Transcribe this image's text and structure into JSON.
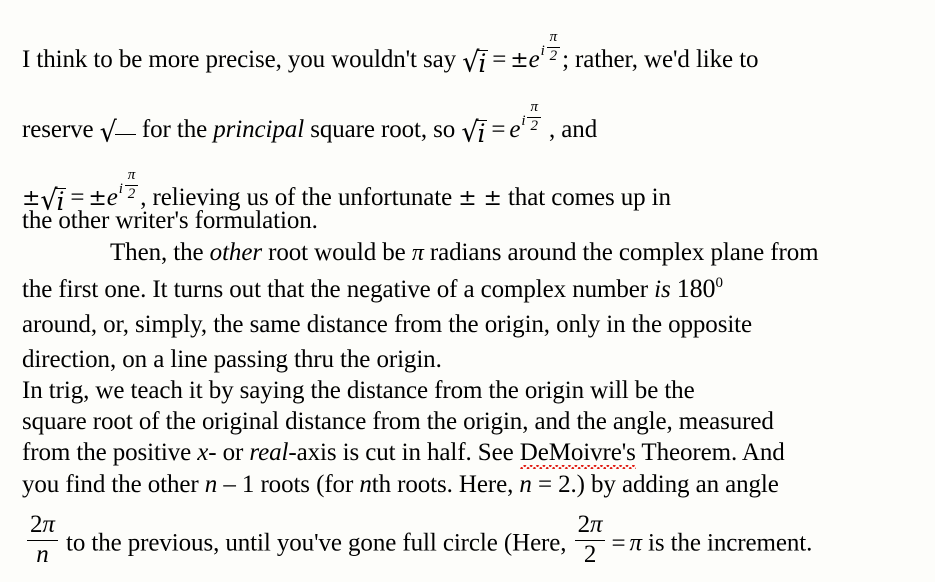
{
  "document": {
    "background_color": "#fdfdfa",
    "text_color": "#000000",
    "spellcheck_underline_color": "#e01b12",
    "lines": {
      "l1_a": "I think to be more precise, you wouldn't say ",
      "l1_b": "; rather, we'd like to",
      "l2_a": "reserve ",
      "l2_b": " for the ",
      "l2_italic": "principal",
      "l2_c": " square root, so ",
      "l2_d": " , and",
      "l3_b": ", relieving us of the unfortunate ",
      "l3_c": " that comes up in",
      "l4": "the other writer's formulation.",
      "l5_a": "Then, the ",
      "l5_italic": "other",
      "l5_b": " root would be ",
      "l5_c": " radians around the complex plane from",
      "l6_a": "the first one.  It turns out that the negative of a complex number ",
      "l6_italic": "is",
      "l6_number": "180",
      "l6_sup": "0",
      "l7": "around, or, simply, the same distance from the origin, only in the opposite",
      "l8": "direction, on a line passing thru the origin.",
      "l9": "In trig, we teach it by saying the distance from the origin will be the",
      "l10": "square root of the original distance from the origin, and the angle, measured",
      "l11_a": "from the positive ",
      "l11_x": "x",
      "l11_b": "- or ",
      "l11_real": "real",
      "l11_c": "-axis is cut in half.  See ",
      "l11_misspelled": "DeMoivre's",
      "l11_d": " Theorem.  And",
      "l12_a": "you find the other ",
      "l12_n1": "n",
      "l12_b": " – 1 roots (for ",
      "l12_n2": "n",
      "l12_c": "th roots.  Here, ",
      "l12_n3": "n",
      "l12_d": " = 2.) by adding an angle",
      "l13_a": " to the previous, until you've gone full circle (Here, ",
      "l13_b": " is the increment."
    },
    "math": {
      "radical_glyph": "√",
      "i": "i",
      "e": "e",
      "pi": "π",
      "n": "n",
      "two": "2",
      "equals": "=",
      "plus_minus": "±",
      "plus_minus_pair": "± ±",
      "comma": ","
    }
  }
}
